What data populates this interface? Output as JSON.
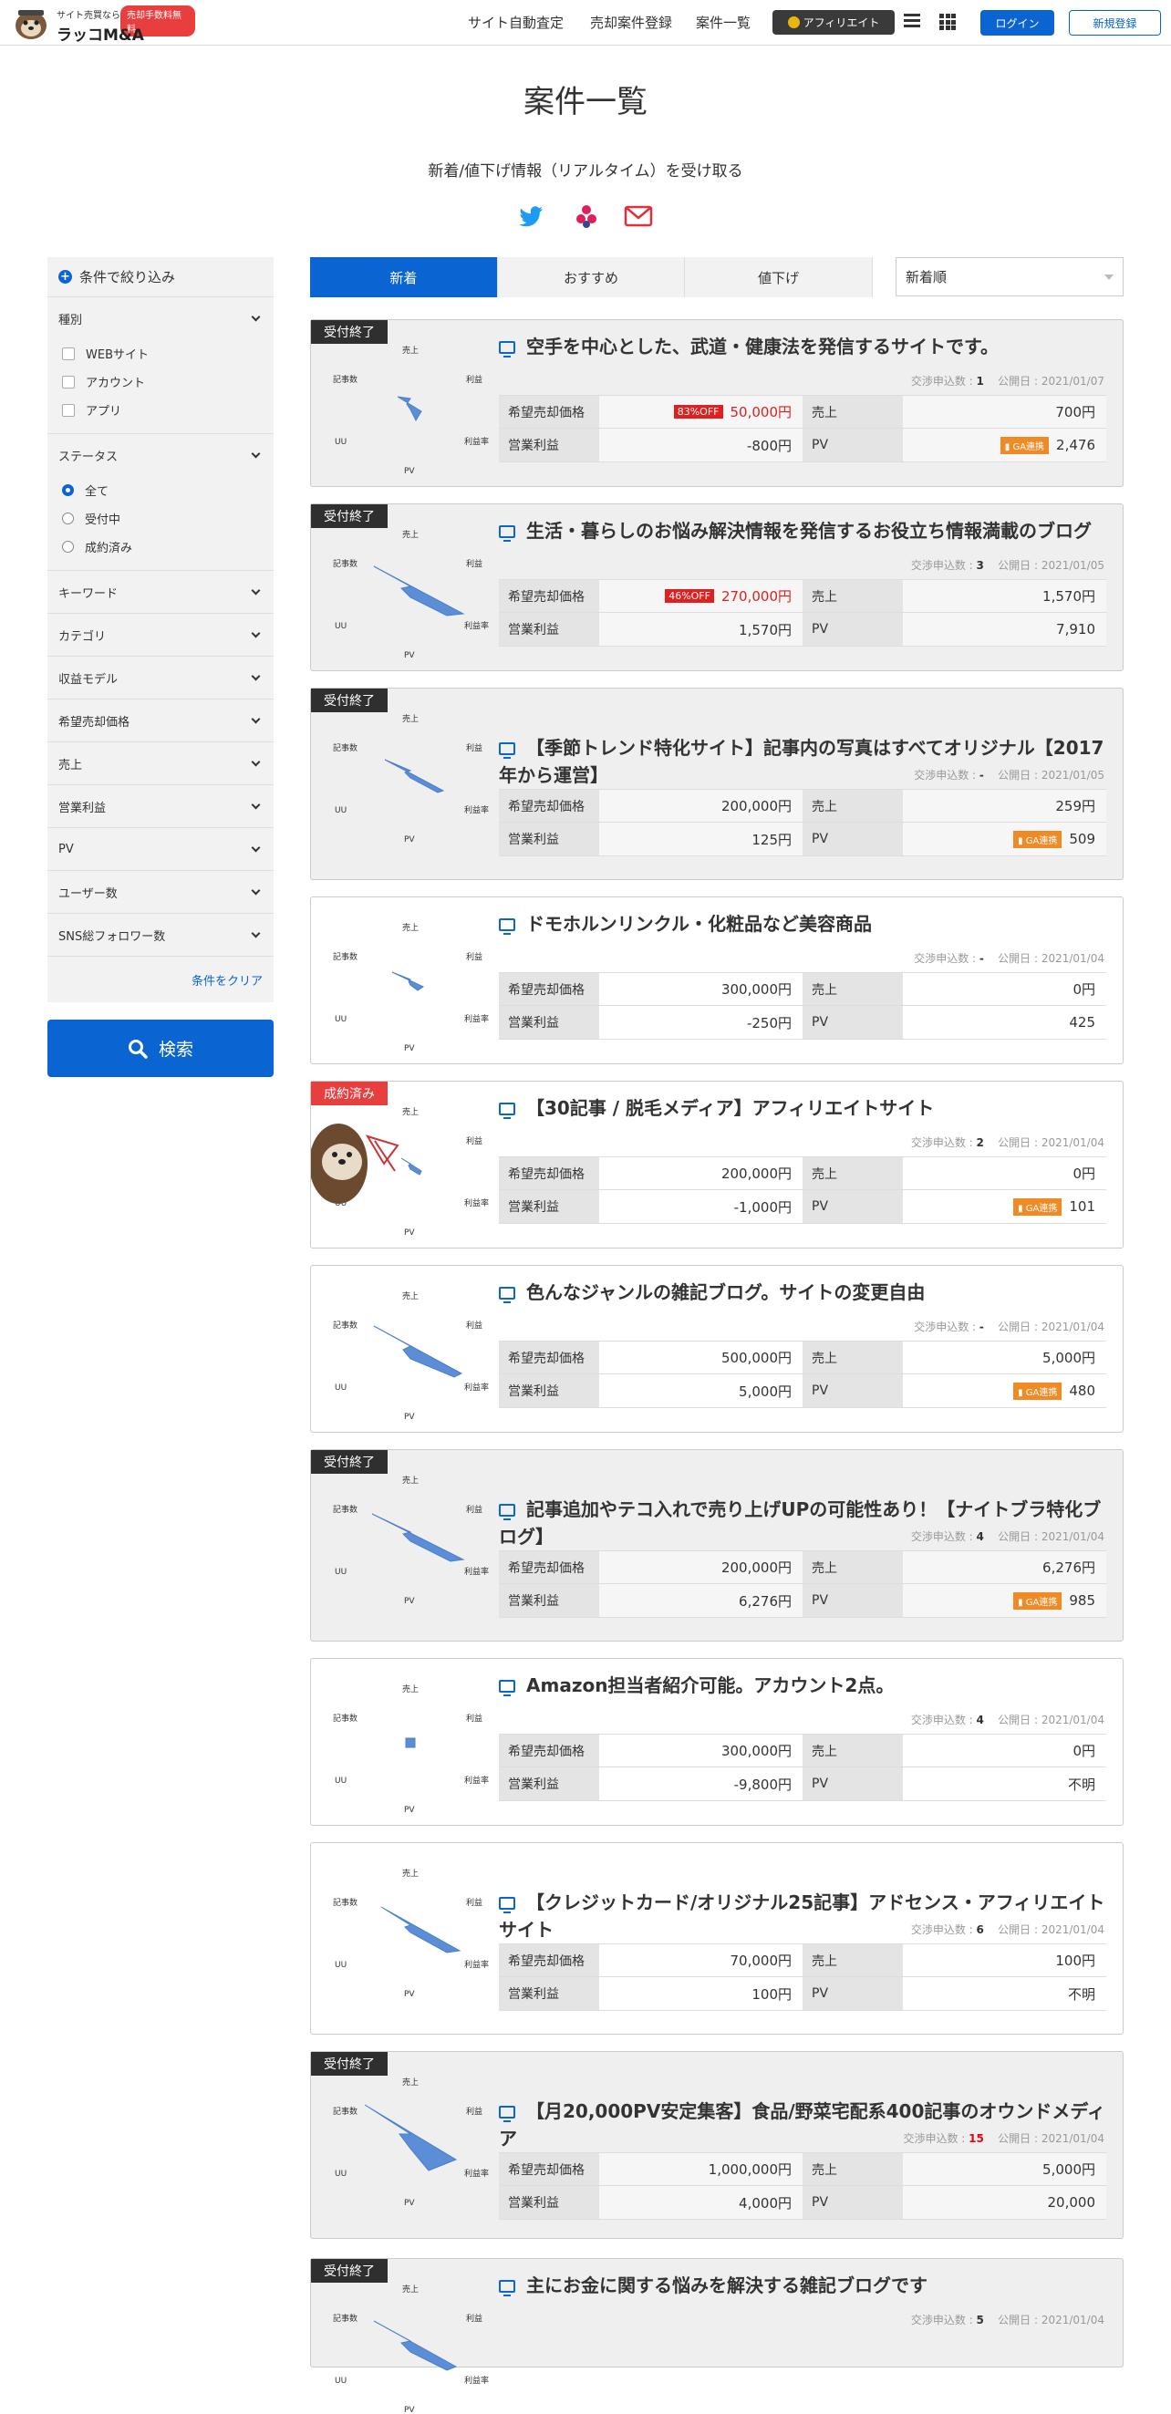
{
  "header": {
    "logo_small": "サイト売買なら",
    "logo_badge": "売却手数料無料",
    "logo_name": "ラッコM&A",
    "nav": [
      "サイト自動査定",
      "売却案件登録",
      "案件一覧"
    ],
    "affiliate": "アフィリエイト",
    "login": "ログイン",
    "signup": "新規登録"
  },
  "page": {
    "title": "案件一覧",
    "subscribe": "新着/値下げ情報（リアルタイム）を受け取る"
  },
  "sidebar": {
    "heading": "条件で絞り込み",
    "type_label": "種別",
    "type_options": [
      "WEBサイト",
      "アカウント",
      "アプリ"
    ],
    "status_label": "ステータス",
    "status_options": [
      "全て",
      "受付中",
      "成約済み"
    ],
    "filters": [
      "キーワード",
      "カテゴリ",
      "収益モデル",
      "希望売却価格",
      "売上",
      "営業利益",
      "PV",
      "ユーザー数",
      "SNS総フォロワー数"
    ],
    "clear": "条件をクリア",
    "search": "検索"
  },
  "tabs": [
    "新着",
    "おすすめ",
    "値下げ"
  ],
  "sort": "新着順",
  "labels": {
    "price": "希望売却価格",
    "sales": "売上",
    "profit": "営業利益",
    "pv": "PV",
    "negotiations": "交渉申込数 :",
    "published": "公開日 :",
    "ga": "GA連携",
    "radar_top": "売上",
    "radar_left": "記事数",
    "radar_right": "利益",
    "radar_bottom_left": "UU",
    "radar_bottom_right": "利益率",
    "radar_bottom": "PV"
  },
  "listings": [
    {
      "ribbon": "受付終了",
      "title": "空手を中心とした、武道・健康法を発信するサイトです。",
      "negotiations": "1",
      "date": "2021/01/07",
      "discount": "83%OFF",
      "price": "50,000円",
      "sales": "700円",
      "profit": "-800円",
      "ga": true,
      "pv": "2,476"
    },
    {
      "ribbon": "受付終了",
      "title": "生活・暮らしのお悩み解決情報を発信するお役立ち情報満載のブログ",
      "negotiations": "3",
      "date": "2021/01/05",
      "discount": "46%OFF",
      "price": "270,000円",
      "sales": "1,570円",
      "profit": "1,570円",
      "ga": false,
      "pv": "7,910"
    },
    {
      "ribbon": "受付終了",
      "title": "【季節トレンド特化サイト】記事内の写真はすべてオリジナル【2017年から運営】",
      "negotiations": "-",
      "date": "2021/01/05",
      "discount": "",
      "price": "200,000円",
      "sales": "259円",
      "profit": "125円",
      "ga": true,
      "pv": "509"
    },
    {
      "ribbon": "",
      "title": "ドモホルンリンクル・化粧品など美容商品",
      "negotiations": "-",
      "date": "2021/01/04",
      "discount": "",
      "price": "300,000円",
      "sales": "0円",
      "profit": "-250円",
      "ga": false,
      "pv": "425"
    },
    {
      "ribbon": "成約済み",
      "title": "【30記事 / 脱毛メディア】アフィリエイトサイト",
      "negotiations": "2",
      "date": "2021/01/04",
      "discount": "",
      "price": "200,000円",
      "sales": "0円",
      "profit": "-1,000円",
      "ga": true,
      "pv": "101"
    },
    {
      "ribbon": "",
      "title": "色んなジャンルの雑記ブログ。サイトの変更自由",
      "negotiations": "-",
      "date": "2021/01/04",
      "discount": "",
      "price": "500,000円",
      "sales": "5,000円",
      "profit": "5,000円",
      "ga": true,
      "pv": "480"
    },
    {
      "ribbon": "受付終了",
      "title": "記事追加やテコ入れで売り上げUPの可能性あり！【ナイトブラ特化ブログ】",
      "negotiations": "4",
      "date": "2021/01/04",
      "discount": "",
      "price": "200,000円",
      "sales": "6,276円",
      "profit": "6,276円",
      "ga": true,
      "pv": "985"
    },
    {
      "ribbon": "",
      "title": "Amazon担当者紹介可能。アカウント2点。",
      "negotiations": "4",
      "date": "2021/01/04",
      "discount": "",
      "price": "300,000円",
      "sales": "0円",
      "profit": "-9,800円",
      "ga": false,
      "pv": "不明"
    },
    {
      "ribbon": "",
      "title": "【クレジットカード/オリジナル25記事】アドセンス・アフィリエイトサイト",
      "negotiations": "6",
      "date": "2021/01/04",
      "discount": "",
      "price": "70,000円",
      "sales": "100円",
      "profit": "100円",
      "ga": false,
      "pv": "不明"
    },
    {
      "ribbon": "受付終了",
      "title": "【月20,000PV安定集客】食品/野菜宅配系400記事のオウンドメディア",
      "negotiations": "15",
      "date": "2021/01/04",
      "discount": "",
      "price": "1,000,000円",
      "sales": "5,000円",
      "profit": "4,000円",
      "ga": false,
      "pv": "20,000"
    },
    {
      "ribbon": "受付終了",
      "title": "主にお金に関する悩みを解決する雑記ブログです",
      "negotiations": "5",
      "date": "2021/01/04",
      "discount": "",
      "price": "",
      "sales": "",
      "profit": "",
      "ga": false,
      "pv": ""
    }
  ]
}
